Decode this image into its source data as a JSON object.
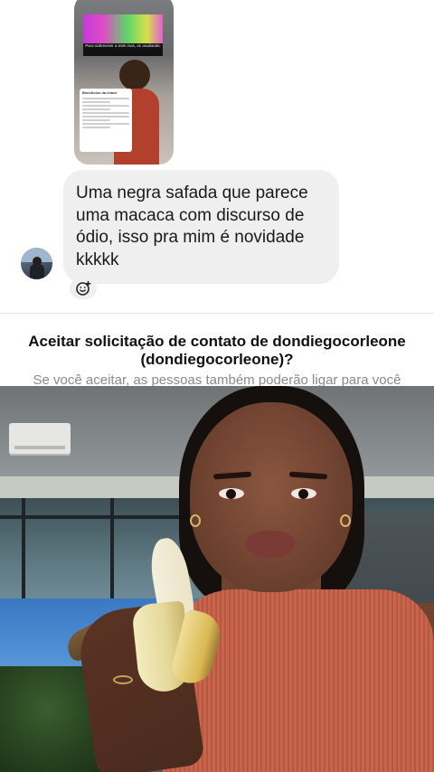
{
  "message_thread": {
    "shared_post": {
      "tv_subtitle": "Para sobreviver a este mas, os avaliando.",
      "card_title": "Benefícios da chave"
    },
    "received_message": {
      "lines": [
        "Uma negra safada que parece",
        "uma macaca com discurso de",
        "ódio, isso pra mim é novidade",
        "kkkkk"
      ]
    },
    "reaction_icon": "add-reaction-icon"
  },
  "contact_request": {
    "title_line1": "Aceitar solicitação de contato de dondiegocorleone",
    "title_line2": "(dondiegocorleone)?",
    "subtitle": "Se você aceitar, as pessoas também poderão ligar para você"
  },
  "colors": {
    "bubble_bg": "#efeff0",
    "text_primary": "#1a1a1a",
    "text_secondary": "#8a8a8a"
  }
}
